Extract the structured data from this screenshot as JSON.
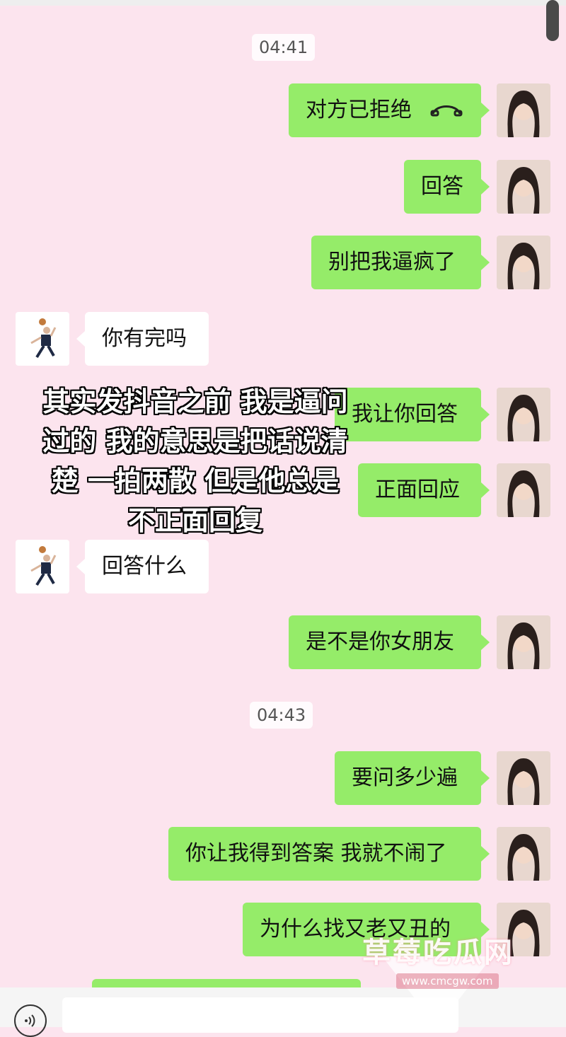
{
  "chat": {
    "timestamps": [
      "04:41",
      "04:43"
    ],
    "messages": [
      {
        "side": "me",
        "text": "对方已拒绝",
        "icon": "hangup-icon"
      },
      {
        "side": "me",
        "text": "回答"
      },
      {
        "side": "me",
        "text": "别把我逼疯了"
      },
      {
        "side": "them",
        "text": "你有完吗"
      },
      {
        "side": "me",
        "text": "我让你回答"
      },
      {
        "side": "me",
        "text": "正面回应"
      },
      {
        "side": "them",
        "text": "回答什么"
      },
      {
        "side": "me",
        "text": "是不是你女朋友"
      },
      {
        "side": "me",
        "text": "要问多少遍"
      },
      {
        "side": "me",
        "text": "你让我得到答案 我就不闹了"
      },
      {
        "side": "me",
        "text": "为什么找又老又丑的"
      }
    ]
  },
  "caption": {
    "lines": [
      "其实发抖音之前 我是逼问",
      "过的 我的意思是把话说清",
      "楚 一拍两散 但是他总是",
      "不正面回复"
    ]
  },
  "watermark": {
    "title": "草莓吃瓜网",
    "url": "www.cmcgw.com"
  },
  "colors": {
    "background": "#fce4ee",
    "me_bubble": "#95ec69",
    "them_bubble": "#ffffff"
  }
}
